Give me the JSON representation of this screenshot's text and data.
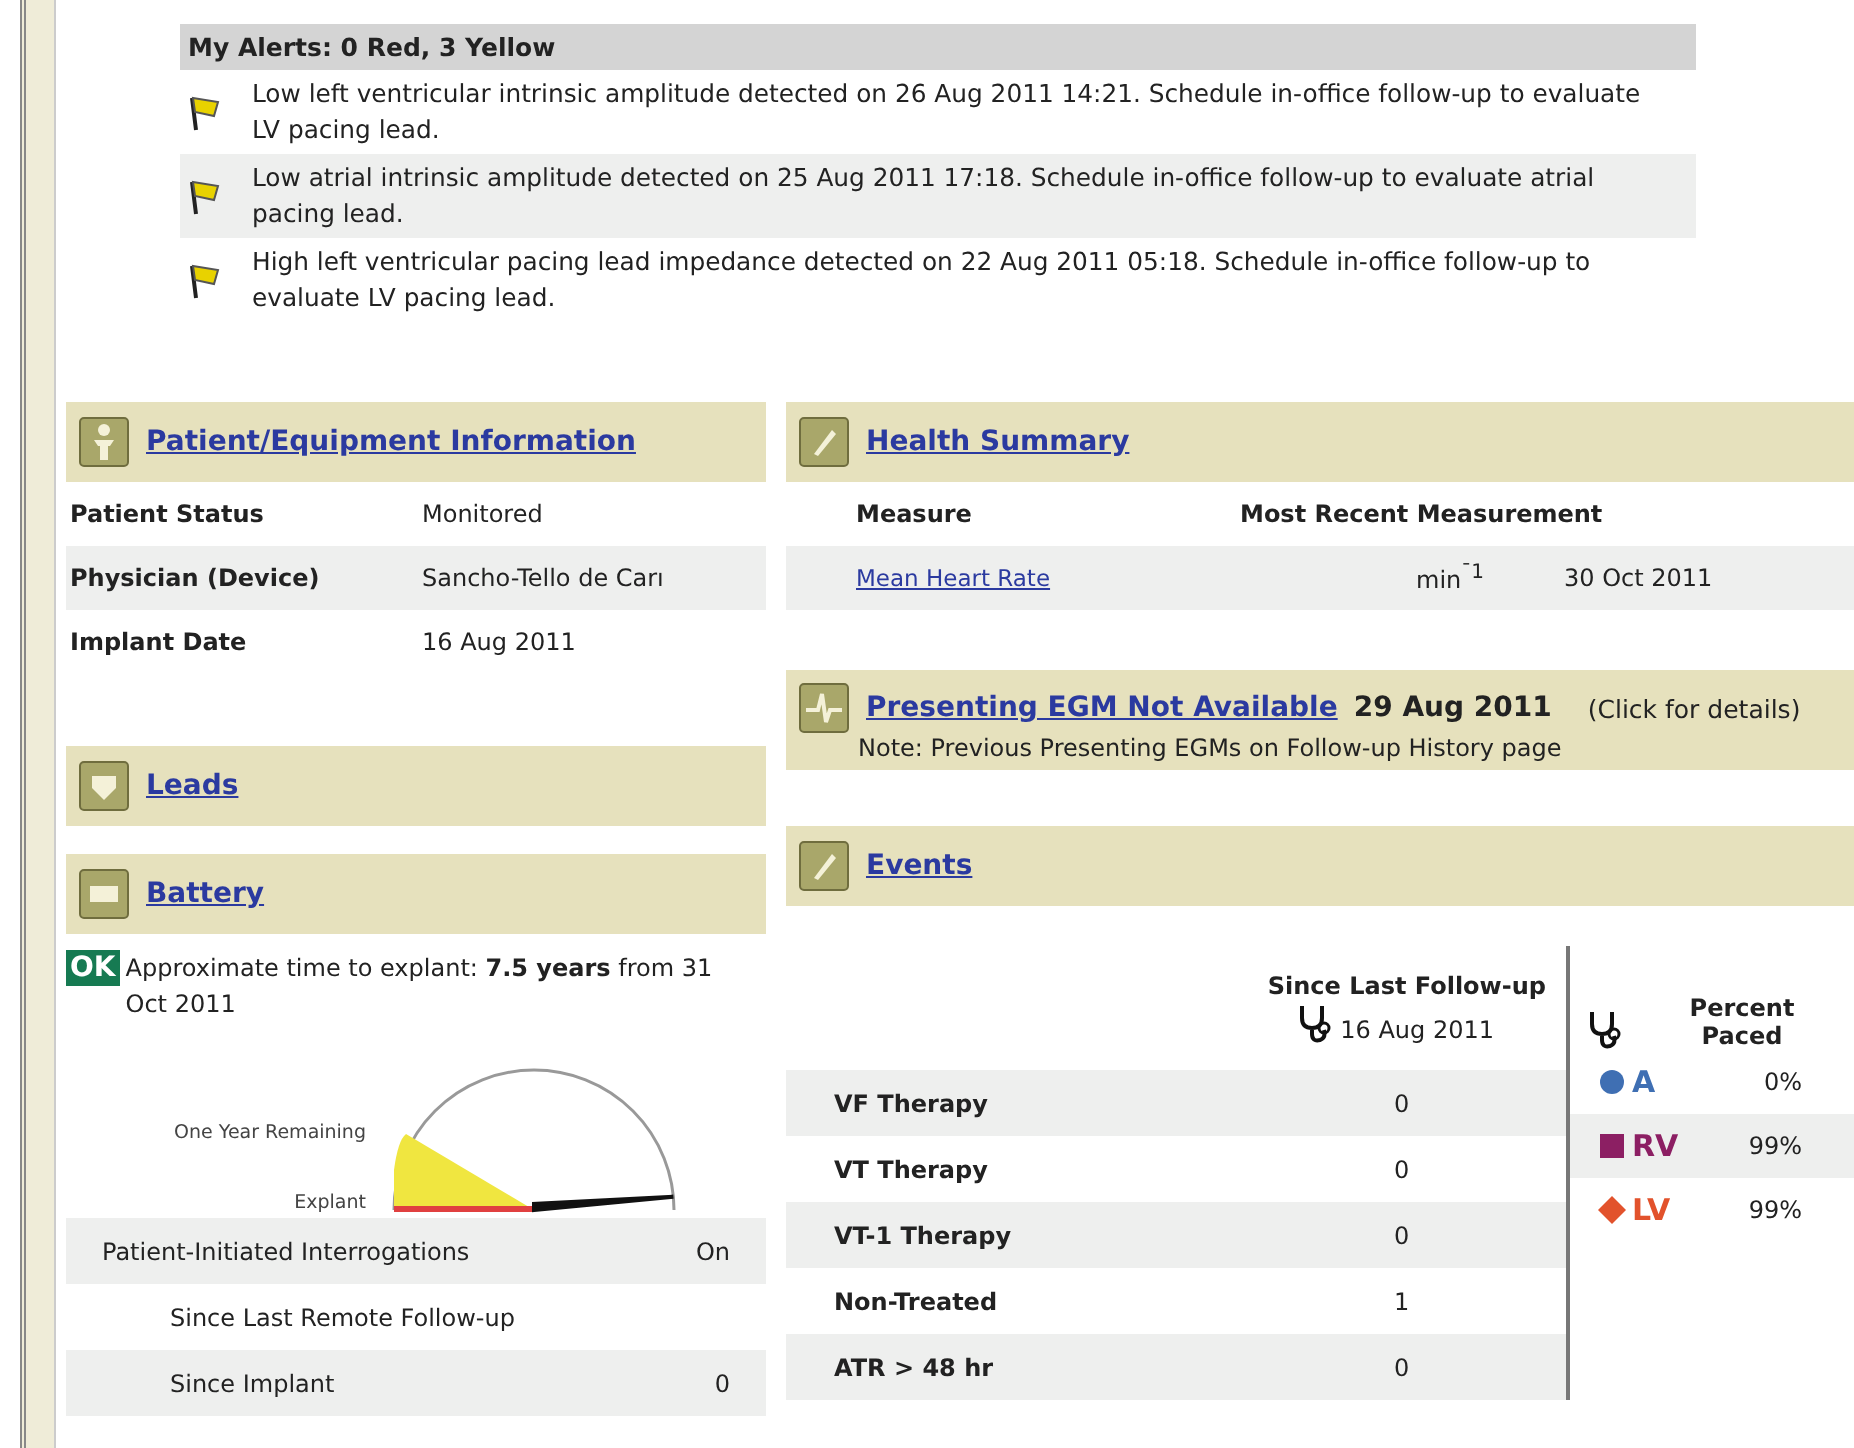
{
  "alerts": {
    "title": "My Alerts: 0 Red, 3 Yellow",
    "items": [
      {
        "text": "Low left ventricular intrinsic amplitude detected on 26 Aug 2011 14:21. Schedule in-office follow-up to evaluate LV pacing lead.",
        "color": "#e8d200"
      },
      {
        "text": "Low atrial intrinsic amplitude detected on 25 Aug 2011 17:18. Schedule in-office follow-up to evaluate atrial pacing lead.",
        "color": "#e8d200"
      },
      {
        "text": "High left ventricular pacing lead impedance detected on 22 Aug 2011 05:18. Schedule in-office follow-up to evaluate LV pacing lead.",
        "color": "#e8d200"
      }
    ]
  },
  "patient": {
    "title": "Patient/Equipment Information",
    "rows": [
      {
        "label": "Patient Status",
        "value": "Monitored"
      },
      {
        "label": "Physician (Device)",
        "value": "Sancho-Tello de Carı"
      },
      {
        "label": "Implant Date",
        "value": "16 Aug 2011"
      }
    ]
  },
  "leads": {
    "title": "Leads"
  },
  "battery": {
    "title": "Battery",
    "status": "OK",
    "text": "Approximate time to explant: **7.5 years** from 31 Oct 2011",
    "gauge": {
      "label_top": "One Year Remaining",
      "label_bottom": "Explant"
    },
    "rows": [
      {
        "label": "Patient-Initiated Interrogations",
        "value": "On",
        "indent": false
      },
      {
        "label": "Since Last Remote Follow-up",
        "indent": true
      },
      {
        "label": "Since Implant",
        "value": "0",
        "indent": true
      }
    ]
  },
  "health": {
    "title": "Health Summary",
    "columns": [
      "Measure",
      "Most Recent Measurement"
    ],
    "rows": [
      {
        "measure": "Mean Heart Rate",
        "unit": "min$^{¯1}$",
        "date": "30 Oct 2011"
      }
    ]
  },
  "egm": {
    "title": "Presenting EGM Not Available",
    "date": "29 Aug 2011",
    "hint": "(Click for details)",
    "note": "Note: Previous Presenting EGMs on Follow-up History page"
  },
  "events": {
    "title": "Events",
    "column": "Since Last Follow-up",
    "column_date": "16 Aug 2011",
    "rows": [
      {
        "label": "VF Therapy",
        "value": "0"
      },
      {
        "label": "VT Therapy",
        "value": "0"
      },
      {
        "label": "VT-1 Therapy",
        "value": "0"
      },
      {
        "label": "Non-Treated",
        "value": "1"
      },
      {
        "label": "ATR > 48 hr",
        "value": "0"
      }
    ],
    "paced_title": "Percent Paced",
    "paced": [
      {
        "chamber": "A",
        "kind": "circle",
        "color": "#3f6fb3",
        "value": "0%"
      },
      {
        "chamber": "RV",
        "kind": "square",
        "color": "#8c1f63",
        "value": "99%"
      },
      {
        "chamber": "LV",
        "kind": "diamond",
        "color": "#e2522c",
        "value": "99%"
      }
    ]
  }
}
